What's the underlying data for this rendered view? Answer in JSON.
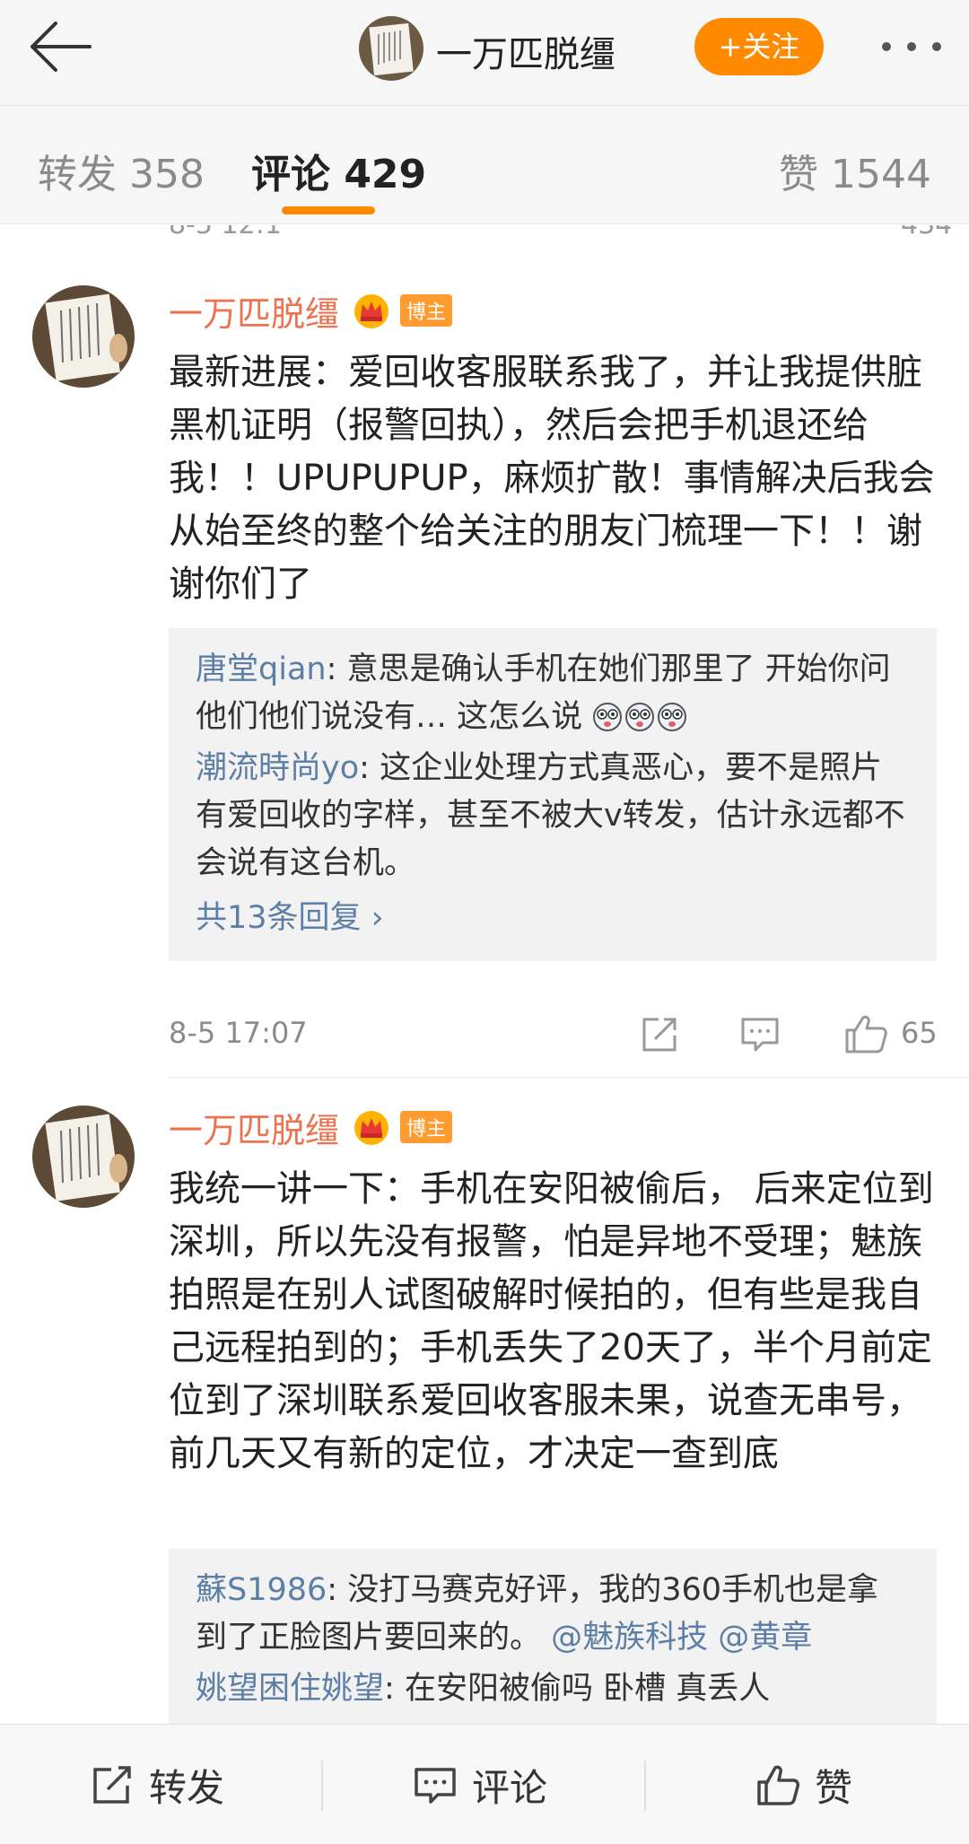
{
  "header": {
    "title": "一万匹脱缰",
    "follow_label": "+关注",
    "back_icon": "back-arrow-icon",
    "more_icon": "more-dots-icon",
    "accent_color": "#ff8a00"
  },
  "tabs": [
    {
      "label": "转发 358"
    },
    {
      "label": "评论 429",
      "active": true
    },
    {
      "label": "赞 1544"
    }
  ],
  "prev_item": {
    "time_fragment": "8-5 12:1",
    "like_fragment": "434"
  },
  "comments": [
    {
      "author": "一万匹脱缰",
      "badge": "博主",
      "text": "最新进展：爱回收客服联系我了，并让我提供脏黑机证明（报警回执），然后会把手机退还给我！！UPUPUPUP，麻烦扩散！事情解决后我会从始至终的整个给关注的朋友门梳理一下！！谢谢你们了",
      "replies": [
        {
          "name": "唐堂qian",
          "sep": ": ",
          "text": "意思是确认手机在她们那里了 开始你问他们他们说没有… 这怎么说"
        },
        {
          "name": "潮流時尚yo",
          "sep": ": ",
          "text": "这企业处理方式真恶心，要不是照片有爱回收的字样，甚至不被大v转发，估计永远都不会说有这台机。"
        }
      ],
      "more_replies": "共13条回复 ›",
      "time": "8-5 17:07",
      "likes": "65"
    },
    {
      "author": "一万匹脱缰",
      "badge": "博主",
      "text": "我统一讲一下：手机在安阳被偷后， 后来定位到深圳，所以先没有报警，怕是异地不受理；魅族拍照是在别人试图破解时候拍的，但有些是我自己远程拍到的；手机丢失了20天了，半个月前定位到了深圳联系爱回收客服未果，说查无串号，前几天又有新的定位，才决定一查到底",
      "replies": [
        {
          "name": "蘇S1986",
          "sep": ": ",
          "text": "没打马赛克好评，我的360手机也是拿到了正脸图片要回来的。",
          "mentions": " @魅族科技 @黄章"
        },
        {
          "name": "姚望困住姚望",
          "sep": ": ",
          "text": "在安阳被偷吗 卧槽 真丢人"
        }
      ]
    }
  ],
  "bottom_bar": {
    "repost_label": "转发",
    "comment_label": "评论",
    "like_label": "赞"
  }
}
